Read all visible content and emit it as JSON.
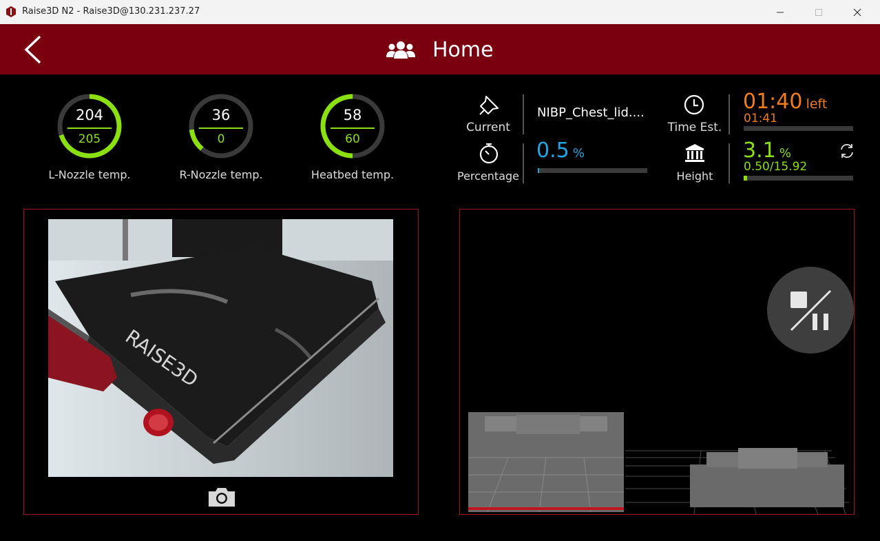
{
  "window": {
    "title": "Raise3D N2 - Raise3D@130.231.237.27"
  },
  "header": {
    "title": "Home"
  },
  "temps": [
    {
      "current": "204",
      "target": "205",
      "label": "L-Nozzle temp.",
      "progress": 0.7
    },
    {
      "current": "36",
      "target": "0",
      "label": "R-Nozzle temp.",
      "progress": 0.12
    },
    {
      "current": "58",
      "target": "60",
      "label": "Heatbed temp.",
      "progress": 0.5
    }
  ],
  "job": {
    "current_label": "Current",
    "file_name": "NIBP_Chest_lid....",
    "percentage_label": "Percentage",
    "percentage_value": "0.5",
    "percentage_unit": "%",
    "percentage_fraction": 0.005
  },
  "time": {
    "label": "Time Est.",
    "remaining": "01:40",
    "left_label": "left",
    "total": "01:41",
    "progress_fraction": 0.0
  },
  "height": {
    "label": "Height",
    "value": "3.1",
    "unit": "%",
    "detail": "0.50/15.92",
    "progress_fraction": 0.031
  },
  "camera": {
    "brand_text": "RAISE3D"
  },
  "colors": {
    "header": "#7a0010",
    "accent_green": "#8ae011",
    "accent_blue": "#1ea7e8",
    "accent_orange": "#f07d1a",
    "panel_border": "#a4121f"
  }
}
